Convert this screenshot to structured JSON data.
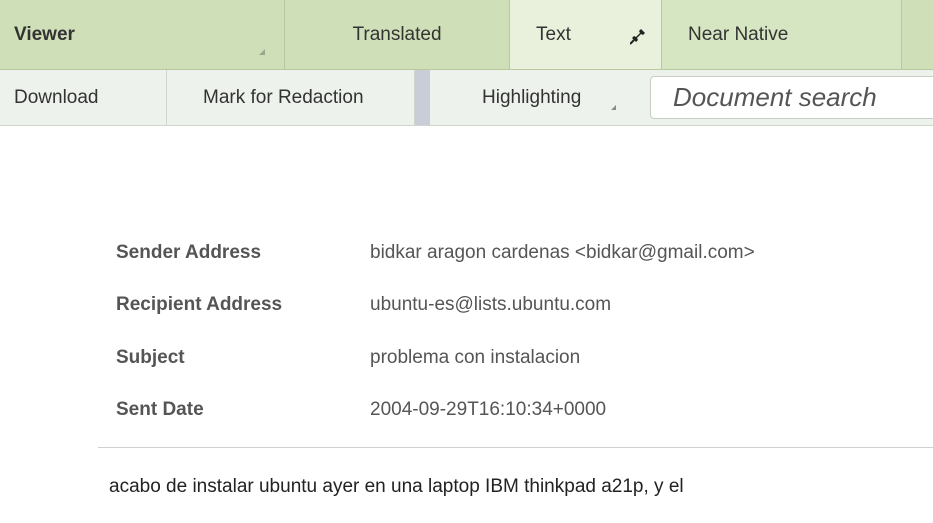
{
  "tabs": {
    "viewer": "Viewer",
    "translated": "Translated",
    "text": "Text",
    "near_native": "Near Native"
  },
  "toolbar": {
    "download": "Download",
    "mark_for_redaction": "Mark for Redaction",
    "highlighting": "Highlighting",
    "search_placeholder": "Document search"
  },
  "email": {
    "fields": [
      {
        "label": "Sender Address",
        "value": "bidkar aragon cardenas <bidkar@gmail.com>"
      },
      {
        "label": "Recipient Address",
        "value": "ubuntu-es@lists.ubuntu.com"
      },
      {
        "label": "Subject",
        "value": "problema con instalacion"
      },
      {
        "label": "Sent Date",
        "value": "2004-09-29T16:10:34+0000"
      }
    ],
    "body": "acabo de instalar ubuntu ayer en una laptop IBM thinkpad a21p, y el"
  },
  "icons": {
    "pin": "pin-icon"
  },
  "colors": {
    "tab_bar": "#cfe0b8",
    "active_tab": "#e9f1dc",
    "toolbar": "#eef2ec"
  }
}
